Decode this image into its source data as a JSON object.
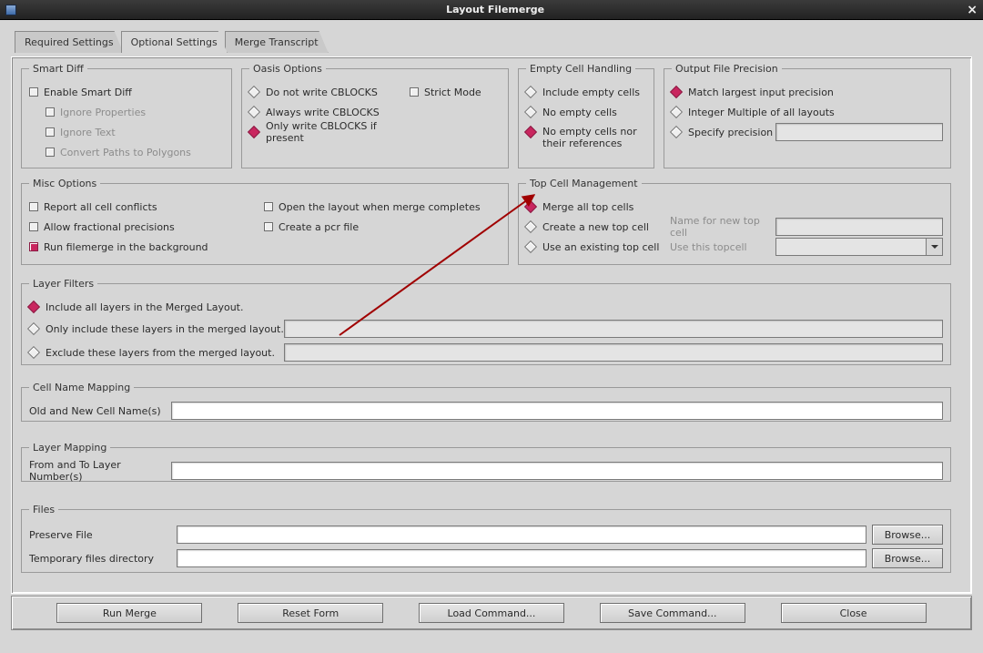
{
  "window": {
    "title": "Layout Filemerge"
  },
  "tabs": {
    "required": "Required Settings",
    "optional": "Optional Settings",
    "transcript": "Merge Transcript",
    "active": "optional"
  },
  "smart_diff": {
    "legend": "Smart Diff",
    "enable": "Enable Smart Diff",
    "ignore_props": "Ignore Properties",
    "ignore_text": "Ignore Text",
    "convert_paths": "Convert Paths to Polygons"
  },
  "oasis": {
    "legend": "Oasis Options",
    "opt_no": "Do not write CBLOCKS",
    "opt_always": "Always write CBLOCKS",
    "opt_present": "Only write CBLOCKS if present",
    "strict": "Strict Mode",
    "selected": "opt_present"
  },
  "empty": {
    "legend": "Empty Cell Handling",
    "include": "Include empty cells",
    "none": "No empty cells",
    "none_refs": "No empty cells nor their references",
    "selected": "none_refs"
  },
  "precision": {
    "legend": "Output File Precision",
    "match": "Match largest input precision",
    "intmul": "Integer Multiple of all layouts",
    "specify": "Specify precision",
    "selected": "match"
  },
  "misc": {
    "legend": "Misc Options",
    "report": "Report all cell conflicts",
    "frac": "Allow fractional precisions",
    "bg": "Run filemerge in the background",
    "open": "Open the layout when merge completes",
    "pcr": "Create a pcr file"
  },
  "topcell": {
    "legend": "Top Cell Management",
    "merge": "Merge all top cells",
    "create": "Create a new top cell",
    "use": "Use an existing top cell",
    "name_ph": "Name for new top cell",
    "use_ph": "Use this topcell",
    "selected": "merge"
  },
  "layer_filters": {
    "legend": "Layer Filters",
    "include_all": "Include all layers in the Merged Layout.",
    "only": "Only include these layers in the merged layout.",
    "exclude": "Exclude these layers from the merged layout.",
    "selected": "include_all"
  },
  "cell_map": {
    "legend": "Cell Name Mapping",
    "label": "Old and New Cell Name(s)"
  },
  "layer_map": {
    "legend": "Layer Mapping",
    "label": "From and To Layer Number(s)"
  },
  "files": {
    "legend": "Files",
    "preserve": "Preserve File",
    "tmpdir": "Temporary files directory",
    "browse": "Browse..."
  },
  "buttons": {
    "run": "Run Merge",
    "reset": "Reset Form",
    "load": "Load Command...",
    "save": "Save Command...",
    "close": "Close"
  }
}
